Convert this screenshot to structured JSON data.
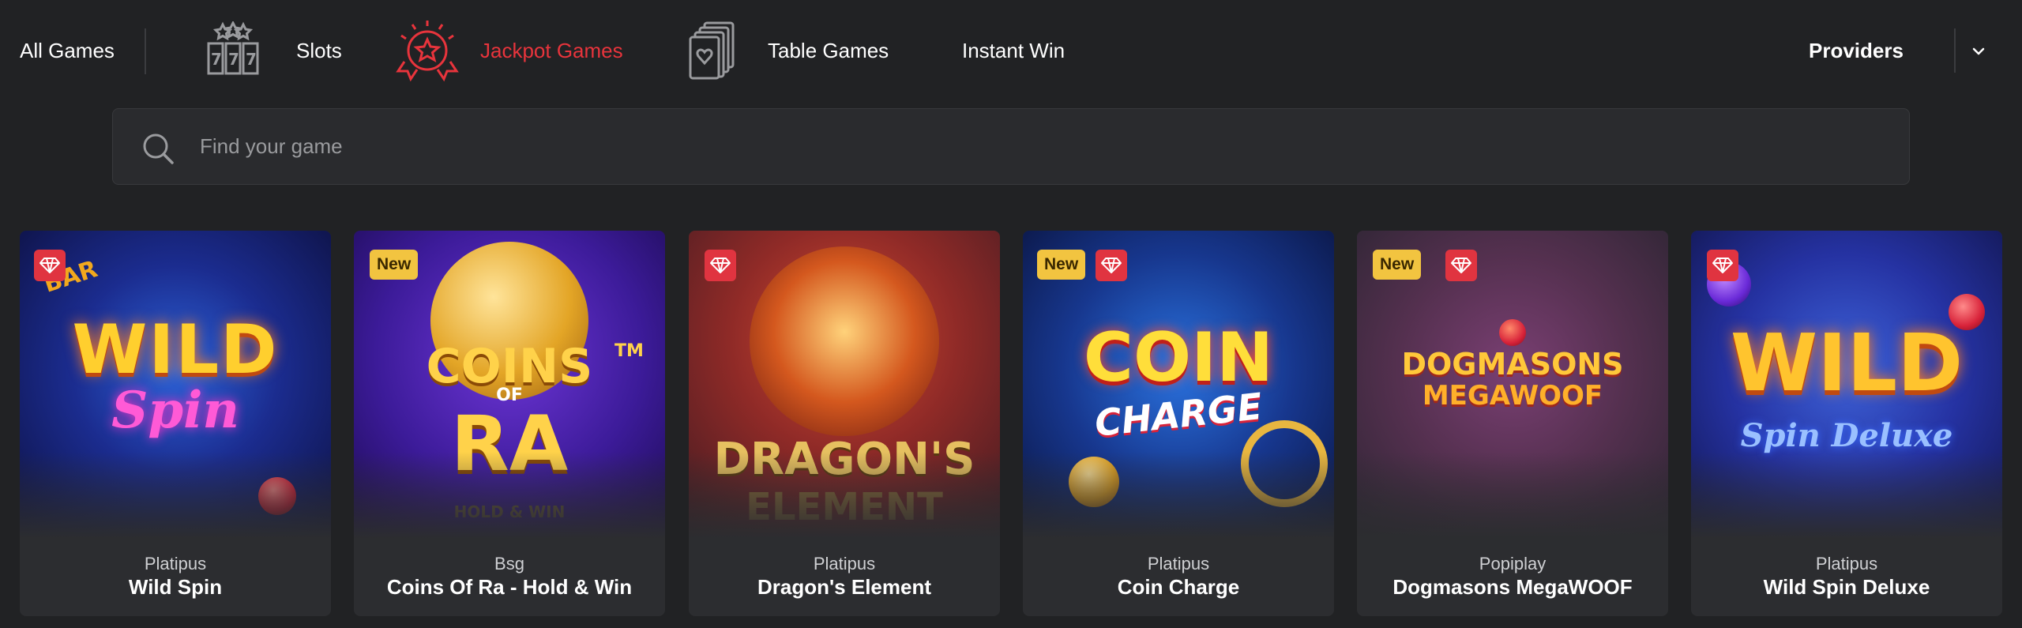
{
  "nav": {
    "all_games": "All Games",
    "slots": "Slots",
    "jackpot": "Jackpot Games",
    "table": "Table Games",
    "instant": "Instant Win",
    "providers": "Providers"
  },
  "search": {
    "placeholder": "Find your game"
  },
  "colors": {
    "background": "#212224",
    "active": "#e8343c",
    "badge_new": "#f2c440",
    "badge_jackpot": "#e03440",
    "tile": "#2c2d30"
  },
  "games": [
    {
      "provider": "Platipus",
      "name": "Wild Spin",
      "badges": [
        "jackpot"
      ]
    },
    {
      "provider": "Bsg",
      "name": "Coins Of Ra - Hold & Win",
      "badges": [
        "new"
      ],
      "art_text": [
        "COINS",
        "OF",
        "RA",
        "TM",
        "HOLD & WIN"
      ]
    },
    {
      "provider": "Platipus",
      "name": "Dragon's Element",
      "badges": [
        "jackpot"
      ],
      "art_text": [
        "DRAGON'S",
        "ELEMENT"
      ]
    },
    {
      "provider": "Platipus",
      "name": "Coin Charge",
      "badges": [
        "new",
        "jackpot"
      ],
      "art_text": [
        "COIN",
        "CHARGE"
      ]
    },
    {
      "provider": "Popiplay",
      "name": "Dogmasons MegaWOOF",
      "badges": [
        "new",
        "jackpot"
      ],
      "art_text": [
        "DOGMASONS",
        "MEGAWOOF"
      ]
    },
    {
      "provider": "Platipus",
      "name": "Wild Spin Deluxe",
      "badges": [
        "jackpot"
      ],
      "art_text": [
        "WILD",
        "Spin Deluxe"
      ]
    }
  ],
  "labels": {
    "new": "New"
  },
  "art": {
    "wild_spin": [
      "BAR",
      "WILD",
      "Spin"
    ]
  }
}
